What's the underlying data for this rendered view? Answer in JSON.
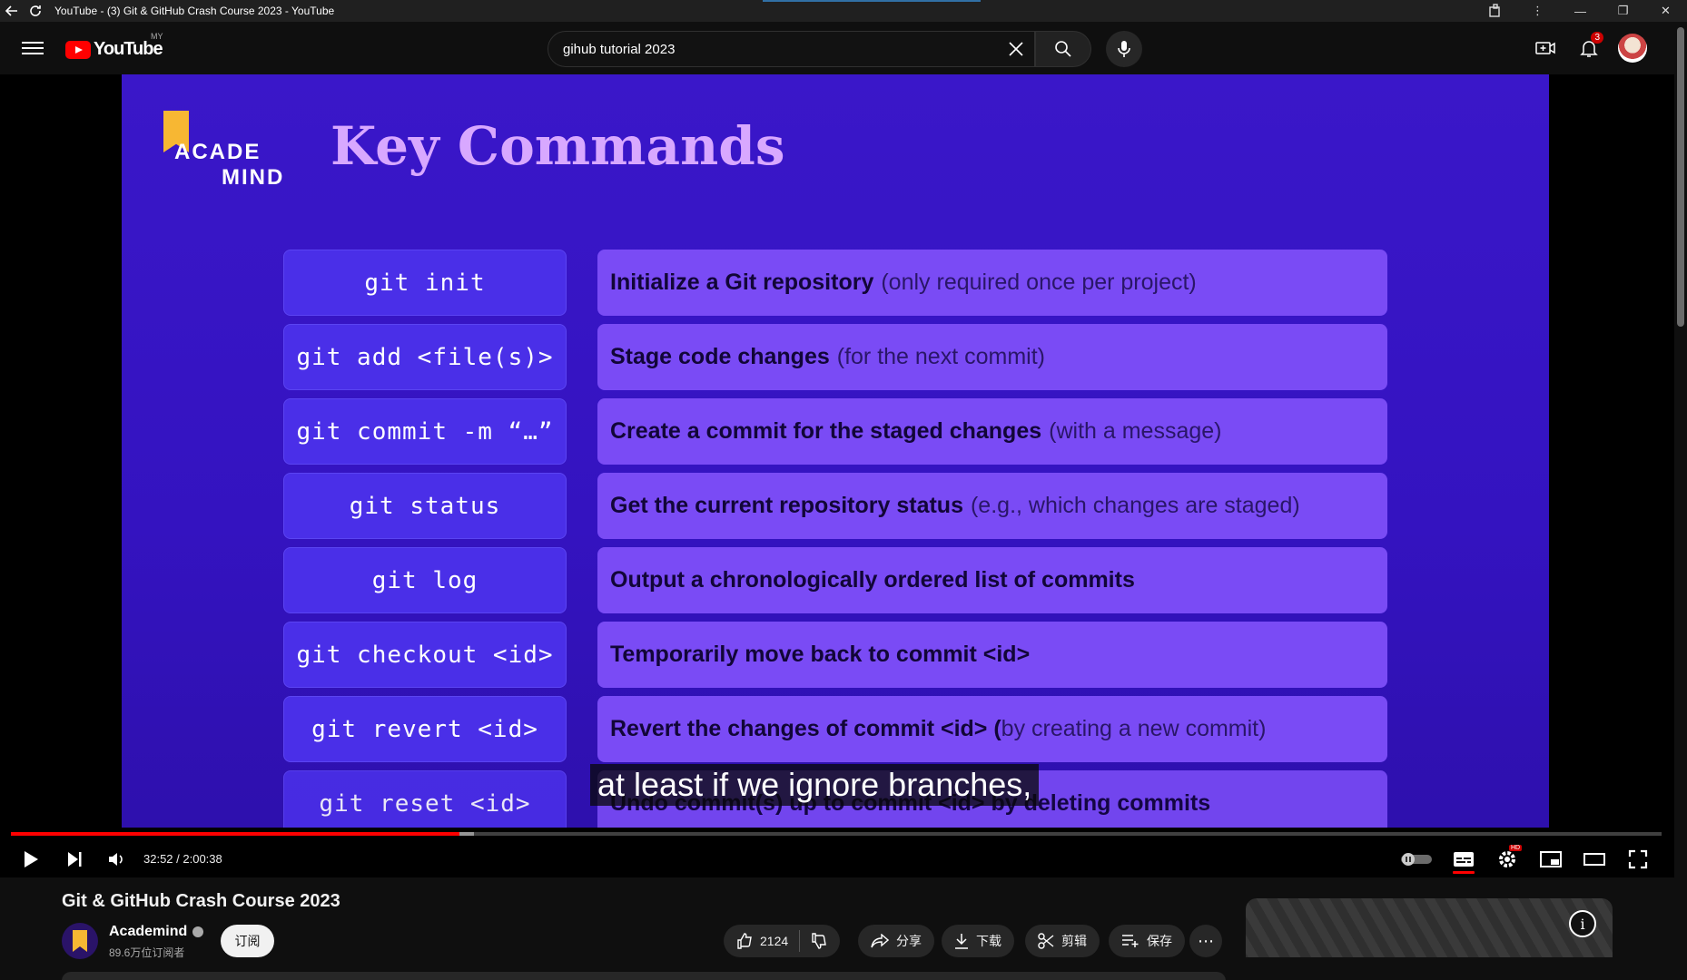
{
  "window": {
    "title": "YouTube - (3) Git & GitHub Crash Course 2023 - YouTube"
  },
  "masthead": {
    "logo_text": "YouTube",
    "region": "MY",
    "search_value": "gihub tutorial 2023",
    "notifications_count": "3"
  },
  "slide": {
    "brand_line1": "ACADE",
    "brand_line2": "MIND",
    "title": "Key Commands",
    "rows": [
      {
        "command": "git init",
        "desc_bold": "Initialize a Git repository",
        "desc_note": "(only required once per project)"
      },
      {
        "command": "git add <file(s)>",
        "desc_bold": "Stage code changes",
        "desc_note": "(for the next commit)"
      },
      {
        "command": "git commit -m “…”",
        "desc_bold": "Create a commit for the staged changes",
        "desc_note": "(with a message)"
      },
      {
        "command": "git status",
        "desc_bold": "Get the current repository status",
        "desc_note": "(e.g., which changes are staged)"
      },
      {
        "command": "git log",
        "desc_bold": "Output a chronologically ordered list of commits",
        "desc_note": ""
      },
      {
        "command": "git checkout <id>",
        "desc_bold": "Temporarily move back to commit <id>",
        "desc_note": ""
      },
      {
        "command": "git revert <id>",
        "desc_bold": "Revert the changes of commit <id> (",
        "desc_note": "by creating a new commit)"
      },
      {
        "command": "git reset <id>",
        "desc_bold": "Undo commit(s) up to commit <id> by deleting commits",
        "desc_note": ""
      }
    ]
  },
  "player": {
    "caption": "at least if we ignore branches,",
    "time_current": "32:52",
    "time_total": "2:00:38",
    "time_display": "32:52 / 2:00:38",
    "progress_fraction": 0.272,
    "hd_badge": "HD"
  },
  "video": {
    "title": "Git & GitHub Crash Course 2023",
    "channel": "Academind",
    "subscribers": "89.6万位订阅者",
    "subscribe_label": "订阅",
    "likes": "2124",
    "share_label": "分享",
    "download_label": "下载",
    "clip_label": "剪辑",
    "save_label": "保存",
    "more_label": "⋯"
  },
  "colors": {
    "accent": "#ff0000",
    "slide_bg": "#3a17c9",
    "command_bg": "#4a2fe8",
    "description_bg": "#7a4bf5",
    "title_color": "#d8a8ff"
  }
}
